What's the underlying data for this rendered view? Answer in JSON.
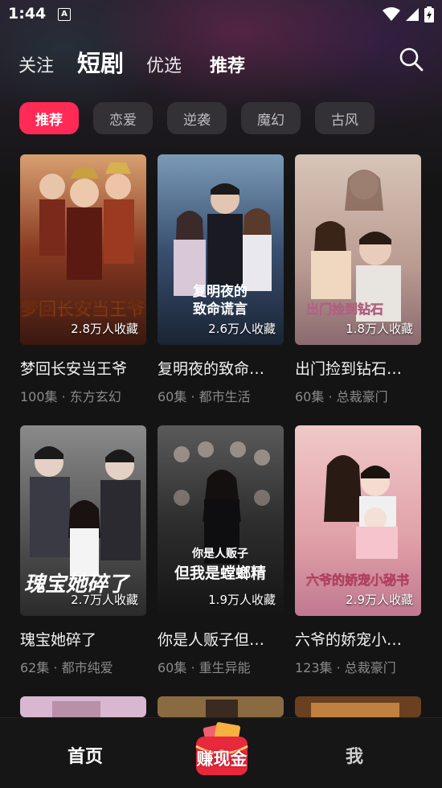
{
  "status": {
    "time": "1:44",
    "notification_icon": "A"
  },
  "top_nav": {
    "tabs": [
      {
        "label": "关注"
      },
      {
        "label": "短剧"
      },
      {
        "label": "优选"
      },
      {
        "label": "推荐"
      }
    ],
    "active_tab": "短剧"
  },
  "chips": [
    {
      "label": "推荐"
    },
    {
      "label": "恋爱"
    },
    {
      "label": "逆袭"
    },
    {
      "label": "魔幻"
    },
    {
      "label": "古风"
    }
  ],
  "cards": [
    {
      "title": "梦回长安当王爷",
      "favorites": "2.8万人收藏",
      "meta": "100集 · 东方玄幻",
      "poster_text": "梦回长安当王爷"
    },
    {
      "title": "复明夜的致命…",
      "favorites": "2.6万人收藏",
      "meta": "60集 · 都市生活",
      "poster_text": "复明夜的致命谎言"
    },
    {
      "title": "出门捡到钻石…",
      "favorites": "1.8万人收藏",
      "meta": "60集 · 总裁豪门",
      "poster_text": "出门捡到钻石"
    },
    {
      "title": "瑰宝她碎了",
      "favorites": "2.7万人收藏",
      "meta": "62集 · 都市纯爱",
      "poster_text": "瑰宝她碎了"
    },
    {
      "title": "你是人贩子但…",
      "favorites": "1.9万人收藏",
      "meta": "60集 · 重生异能",
      "poster_text": "你是人贩子 但我是螳螂精"
    },
    {
      "title": "六爷的娇宠小…",
      "favorites": "2.9万人收藏",
      "meta": "123集 · 总裁豪门",
      "poster_text": "六爷的娇宠小秘书"
    }
  ],
  "bottom_nav": {
    "home": "首页",
    "earn": "赚现金",
    "me": "我"
  },
  "colors": {
    "accent": "#ff2a55",
    "background": "#141414",
    "chip_bg": "#333136"
  }
}
